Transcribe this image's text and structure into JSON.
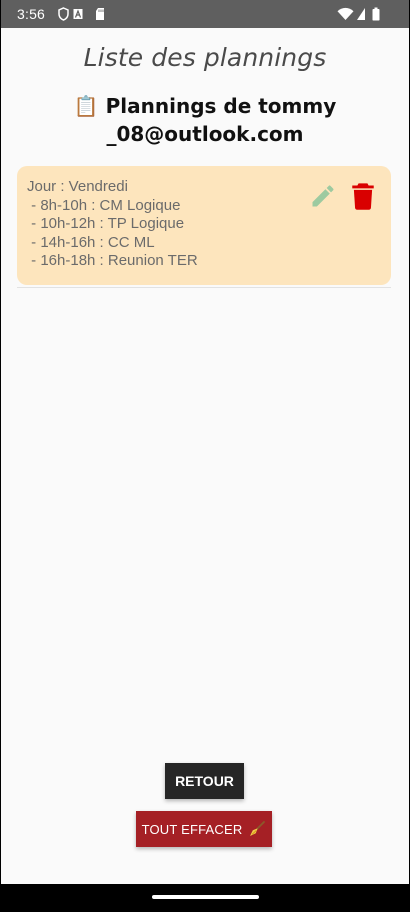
{
  "status_bar": {
    "time": "3:56",
    "left_icons": [
      "shield-icon",
      "a-badge-icon",
      "sd-card-icon"
    ],
    "right_icons": [
      "wifi-icon",
      "signal-icon",
      "battery-icon"
    ]
  },
  "header": {
    "title": "Liste des plannings",
    "subtitle": "📋 Plannings de tommy _08@outlook.com"
  },
  "planning_card": {
    "background_color": "#fde5bd",
    "lines": [
      "Jour : Vendredi",
      " - 8h-10h : CM Logique",
      " - 10h-12h : TP Logique",
      " - 14h-16h : CC ML",
      " - 16h-18h : Reunion TER"
    ],
    "actions": {
      "edit_icon": "pencil-icon",
      "delete_icon": "trash-icon",
      "edit_color": "#9dcaa0",
      "delete_color": "#d90000"
    }
  },
  "buttons": {
    "back_label": "RETOUR",
    "clear_label": "TOUT EFFACER",
    "clear_icon": "broom-icon",
    "back_color": "#262626",
    "clear_color": "#a52025"
  }
}
